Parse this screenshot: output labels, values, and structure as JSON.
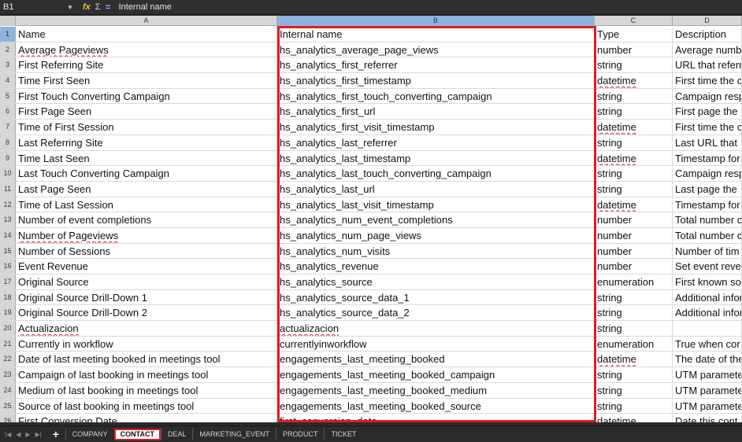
{
  "formula_bar": {
    "cell_ref": "B1",
    "content": "Internal name",
    "icons": [
      "function-wizard-icon",
      "sum-icon",
      "equals-icon"
    ]
  },
  "columns": [
    {
      "letter": "A",
      "selected": false
    },
    {
      "letter": "B",
      "selected": true
    },
    {
      "letter": "C",
      "selected": false
    },
    {
      "letter": "D",
      "selected": false
    }
  ],
  "rows": [
    {
      "num": "1",
      "a": "Name",
      "b": "Internal name",
      "c": "Type",
      "d": "Description"
    },
    {
      "num": "2",
      "a": "Average Pageviews",
      "b": "hs_analytics_average_page_views",
      "c": "number",
      "d": "Average numb"
    },
    {
      "num": "3",
      "a": "First Referring Site",
      "b": "hs_analytics_first_referrer",
      "c": "string",
      "d": "URL that referr"
    },
    {
      "num": "4",
      "a": "Time First Seen",
      "b": "hs_analytics_first_timestamp",
      "c": "datetime",
      "d": "First time the c"
    },
    {
      "num": "5",
      "a": "First Touch Converting Campaign",
      "b": "hs_analytics_first_touch_converting_campaign",
      "c": "string",
      "d": "Campaign resp"
    },
    {
      "num": "6",
      "a": "First Page Seen",
      "b": "hs_analytics_first_url",
      "c": "string",
      "d": "First page the"
    },
    {
      "num": "7",
      "a": "Time of First Session",
      "b": "hs_analytics_first_visit_timestamp",
      "c": "datetime",
      "d": "First time the c"
    },
    {
      "num": "8",
      "a": "Last Referring Site",
      "b": "hs_analytics_last_referrer",
      "c": "string",
      "d": "Last URL that"
    },
    {
      "num": "9",
      "a": "Time Last Seen",
      "b": "hs_analytics_last_timestamp",
      "c": "datetime",
      "d": "Timestamp for"
    },
    {
      "num": "10",
      "a": "Last Touch Converting Campaign",
      "b": "hs_analytics_last_touch_converting_campaign",
      "c": "string",
      "d": "Campaign resp"
    },
    {
      "num": "11",
      "a": "Last Page Seen",
      "b": "hs_analytics_last_url",
      "c": "string",
      "d": "Last page the"
    },
    {
      "num": "12",
      "a": "Time of Last Session",
      "b": "hs_analytics_last_visit_timestamp",
      "c": "datetime",
      "d": "Timestamp for"
    },
    {
      "num": "13",
      "a": "Number of event completions",
      "b": "hs_analytics_num_event_completions",
      "c": "number",
      "d": "Total number c"
    },
    {
      "num": "14",
      "a": "Number of Pageviews",
      "b": "hs_analytics_num_page_views",
      "c": "number",
      "d": "Total number c"
    },
    {
      "num": "15",
      "a": "Number of Sessions",
      "b": "hs_analytics_num_visits",
      "c": "number",
      "d": "Number of tim"
    },
    {
      "num": "16",
      "a": "Event Revenue",
      "b": "hs_analytics_revenue",
      "c": "number",
      "d": "Set event reve"
    },
    {
      "num": "17",
      "a": "Original Source",
      "b": "hs_analytics_source",
      "c": "enumeration",
      "d": "First known so"
    },
    {
      "num": "18",
      "a": "Original Source Drill-Down 1",
      "b": "hs_analytics_source_data_1",
      "c": "string",
      "d": "Additional infor"
    },
    {
      "num": "19",
      "a": "Original Source Drill-Down 2",
      "b": "hs_analytics_source_data_2",
      "c": "string",
      "d": "Additional infor"
    },
    {
      "num": "20",
      "a": "Actualizacion",
      "b": "actualizacion",
      "c": "string",
      "d": ""
    },
    {
      "num": "21",
      "a": "Currently in workflow",
      "b": "currentlyinworkflow",
      "c": "enumeration",
      "d": "True when cor"
    },
    {
      "num": "22",
      "a": "Date of last meeting booked in meetings tool",
      "b": "engagements_last_meeting_booked",
      "c": "datetime",
      "d": "The date of the"
    },
    {
      "num": "23",
      "a": "Campaign of last booking in meetings tool",
      "b": "engagements_last_meeting_booked_campaign",
      "c": "string",
      "d": "UTM paramete"
    },
    {
      "num": "24",
      "a": "Medium of last booking in meetings tool",
      "b": "engagements_last_meeting_booked_medium",
      "c": "string",
      "d": "UTM paramete"
    },
    {
      "num": "25",
      "a": "Source of last booking in meetings tool",
      "b": "engagements_last_meeting_booked_source",
      "c": "string",
      "d": "UTM paramete"
    },
    {
      "num": "26",
      "a": "First Conversion Date",
      "b": "first_conversion_date",
      "c": "datetime",
      "d": "Date this cont"
    }
  ],
  "sheet_tabs": [
    {
      "label": "COMPANY",
      "active": false
    },
    {
      "label": "CONTACT",
      "active": true
    },
    {
      "label": "DEAL",
      "active": false
    },
    {
      "label": "MARKETING_EVENT",
      "active": false
    },
    {
      "label": "PRODUCT",
      "active": false
    },
    {
      "label": "TICKET",
      "active": false
    }
  ],
  "highlight_color": "#e01b24",
  "selection_color": "#8fb4dc"
}
